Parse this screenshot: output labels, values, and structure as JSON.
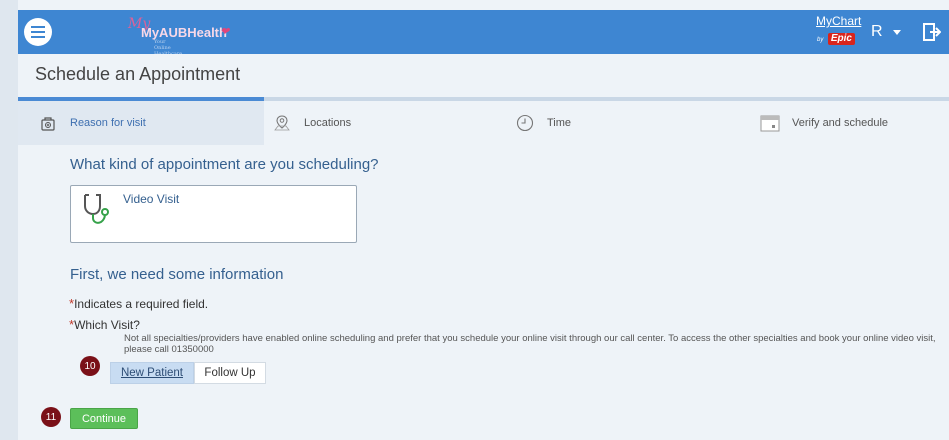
{
  "header": {
    "logo": "MyAUBHealth",
    "logo_tagline": "Your Online Healthcare",
    "mychart": "MyChart",
    "mychart_by": "by",
    "mychart_epic": "Epic",
    "user_initial": "R"
  },
  "page": {
    "title": "Schedule an Appointment"
  },
  "steps": [
    {
      "label": "Reason for visit",
      "icon": "medkit-icon",
      "active": true
    },
    {
      "label": "Locations",
      "icon": "location-icon",
      "active": false
    },
    {
      "label": "Time",
      "icon": "clock-icon",
      "active": false
    },
    {
      "label": "Verify and schedule",
      "icon": "calendar-icon",
      "active": false
    }
  ],
  "appointment": {
    "question": "What kind of appointment are you scheduling?",
    "selected_type": "Video Visit",
    "icon": "stethoscope-icon"
  },
  "info": {
    "heading": "First, we need some information",
    "required_note": "Indicates a required field.",
    "required_star": "*",
    "which_visit_label": "Which Visit?",
    "note": "Not all specialties/providers have enabled online scheduling and prefer that you schedule your online visit through our call center. To access the other specialties and book your online video visit, please call 01350000",
    "options": [
      "New Patient",
      "Follow Up"
    ],
    "selected_option": "New Patient"
  },
  "badges": {
    "options": "10",
    "continue": "11"
  },
  "actions": {
    "continue": "Continue"
  },
  "colors": {
    "topbar": "#3e86d2",
    "accent": "#35608f",
    "continue": "#5cbf5a",
    "badge": "#7a1018",
    "required": "#c0392b"
  }
}
